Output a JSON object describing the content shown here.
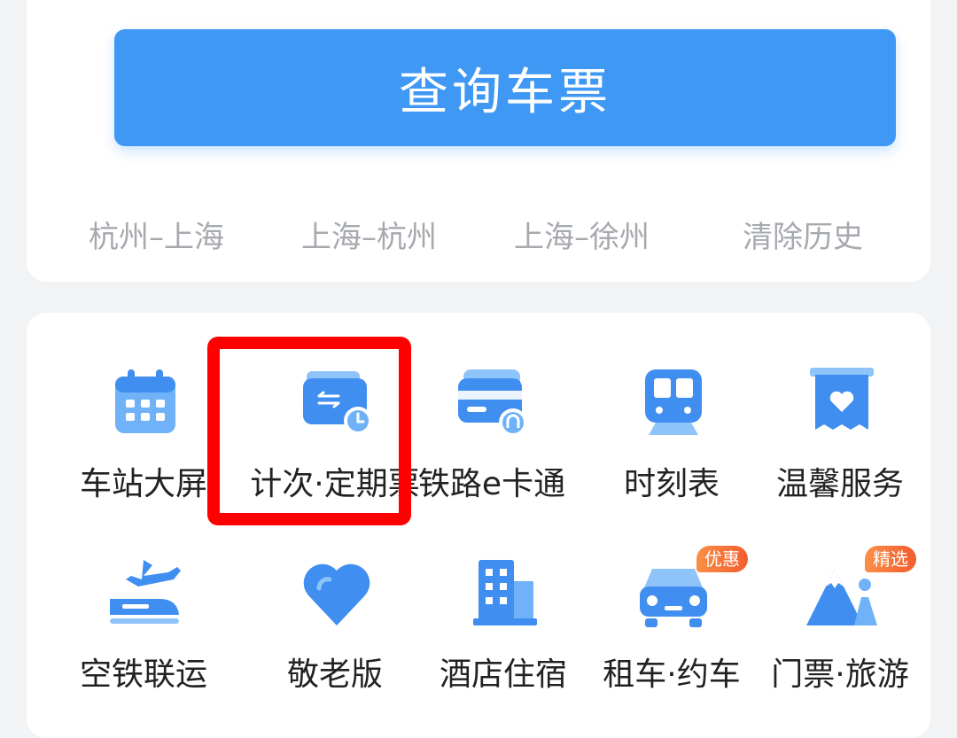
{
  "search": {
    "button_label": "查询车票"
  },
  "history": {
    "items": [
      "杭州–上海",
      "上海–杭州",
      "上海–徐州"
    ],
    "clear_label": "清除历史"
  },
  "grid": {
    "items": [
      {
        "label": "车站大屏",
        "icon": "calendar-icon"
      },
      {
        "label": "计次·定期票",
        "icon": "wallet-clock-icon"
      },
      {
        "label": "铁路e卡通",
        "icon": "railway-card-icon"
      },
      {
        "label": "时刻表",
        "icon": "train-icon"
      },
      {
        "label": "温馨服务",
        "icon": "heart-bag-icon"
      },
      {
        "label": "空铁联运",
        "icon": "plane-train-icon"
      },
      {
        "label": "敬老版",
        "icon": "heart-icon"
      },
      {
        "label": "酒店住宿",
        "icon": "hotel-building-icon"
      },
      {
        "label": "租车·约车",
        "icon": "car-icon",
        "badge": "优惠"
      },
      {
        "label": "门票·旅游",
        "icon": "mountain-icon",
        "badge": "精选"
      }
    ]
  },
  "colors": {
    "accent": "#3f98f4",
    "highlight": "#ff0000",
    "badge": "#f35d2d"
  }
}
